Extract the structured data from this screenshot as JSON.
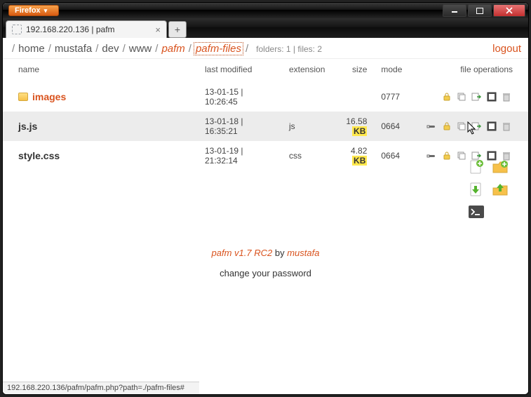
{
  "window": {
    "firefox_label": "Firefox"
  },
  "tab": {
    "title": "192.168.220.136 | pafm"
  },
  "breadcrumb": {
    "segments": [
      "home",
      "mustafa",
      "dev",
      "www",
      "pafm",
      "pafm-files"
    ],
    "counts": "folders: 1 | files: 2",
    "logout": "logout"
  },
  "headers": {
    "name": "name",
    "modified": "last modified",
    "ext": "extension",
    "size": "size",
    "mode": "mode",
    "ops": "file operations"
  },
  "rows": [
    {
      "type": "folder",
      "name": "images",
      "modified": "13-01-15 | 10:26:45",
      "ext": "",
      "size": "",
      "mode": "0777"
    },
    {
      "type": "file",
      "name": "js.js",
      "modified": "13-01-18 | 16:35:21",
      "ext": "js",
      "size_num": "16.58",
      "size_unit": "KB",
      "mode": "0664"
    },
    {
      "type": "file",
      "name": "style.css",
      "modified": "13-01-19 | 21:32:14",
      "ext": "css",
      "size_num": "4.82",
      "size_unit": "KB",
      "mode": "0664"
    }
  ],
  "footer": {
    "version": "pafm v1.7 RC2",
    "by": " by ",
    "author": "mustafa",
    "change_pw": "change your password"
  },
  "statusbar": "192.168.220.136/pafm/pafm.php?path=./pafm-files#"
}
